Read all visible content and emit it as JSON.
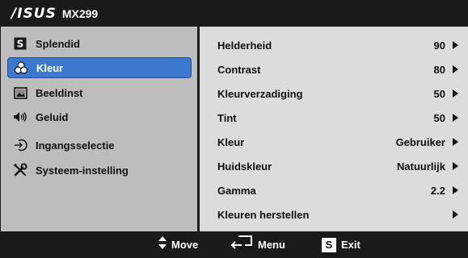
{
  "header": {
    "brand": "/ISUS",
    "model": "MX299"
  },
  "sidebar": {
    "items": [
      {
        "label": "Splendid",
        "icon": "splendid-s-icon"
      },
      {
        "label": "Kleur",
        "icon": "color-palette-icon",
        "selected": true
      },
      {
        "label": "Beeldinst",
        "icon": "image-icon"
      },
      {
        "label": "Geluid",
        "icon": "speaker-icon"
      },
      {
        "label": "Ingangsselectie",
        "icon": "input-arrow-icon"
      },
      {
        "label": "Systeem-instelling",
        "icon": "tools-icon"
      }
    ]
  },
  "settings": {
    "rows": [
      {
        "name": "Helderheid",
        "value": "90"
      },
      {
        "name": "Contrast",
        "value": "80"
      },
      {
        "name": "Kleurverzadiging",
        "value": "50"
      },
      {
        "name": "Tint",
        "value": "50"
      },
      {
        "name": "Kleur",
        "value": "Gebruiker"
      },
      {
        "name": "Huidskleur",
        "value": "Natuurlijk"
      },
      {
        "name": "Gamma",
        "value": "2.2"
      },
      {
        "name": "Kleuren herstellen",
        "value": ""
      }
    ]
  },
  "footer": {
    "move_label": "Move",
    "menu_label": "Menu",
    "exit_label": "Exit",
    "exit_key": "S"
  },
  "colors": {
    "selected": "#3c78d0",
    "sidebar_bg": "#bdbdbd",
    "panel_bg": "#dcdcdc",
    "bar_bg": "#1a1a1a"
  }
}
